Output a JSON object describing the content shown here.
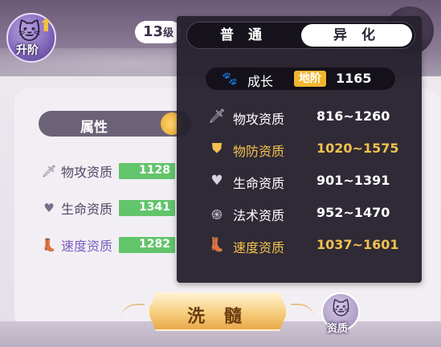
{
  "header": {
    "levelup_label": "升阶",
    "level_value": "13",
    "level_unit": "级"
  },
  "attributes_panel": {
    "tab_label": "属性",
    "stats": [
      {
        "name": "物攻资质",
        "value": "1128",
        "icon": "sword-icon"
      },
      {
        "name": "生命资质",
        "value": "1341",
        "icon": "heart-icon"
      },
      {
        "name": "速度资质",
        "value": "1282",
        "icon": "boot-icon"
      }
    ]
  },
  "popup": {
    "tabs": {
      "normal": "普 通",
      "mutant": "异 化",
      "active": "mutant"
    },
    "growth": {
      "label": "成长",
      "badge": "地阶",
      "value": "1165"
    },
    "aptitudes": [
      {
        "name": "物攻资质",
        "range": "816~1260",
        "icon": "sword-icon",
        "highlight": false
      },
      {
        "name": "物防资质",
        "range": "1020~1575",
        "icon": "shield-icon",
        "highlight": true
      },
      {
        "name": "生命资质",
        "range": "901~1391",
        "icon": "heart-icon",
        "highlight": false
      },
      {
        "name": "法术资质",
        "range": "952~1470",
        "icon": "swirl-icon",
        "highlight": false
      },
      {
        "name": "速度资质",
        "range": "1037~1601",
        "icon": "boot-icon",
        "highlight": true
      }
    ]
  },
  "footer": {
    "wash_button": "洗 髓",
    "aptitude_label": "资质"
  },
  "colors": {
    "highlight_gold": "#f2c14e",
    "bar_green": "#62c46b",
    "badge_gold": "#f0b72e",
    "popup_bg": "#26212e"
  }
}
